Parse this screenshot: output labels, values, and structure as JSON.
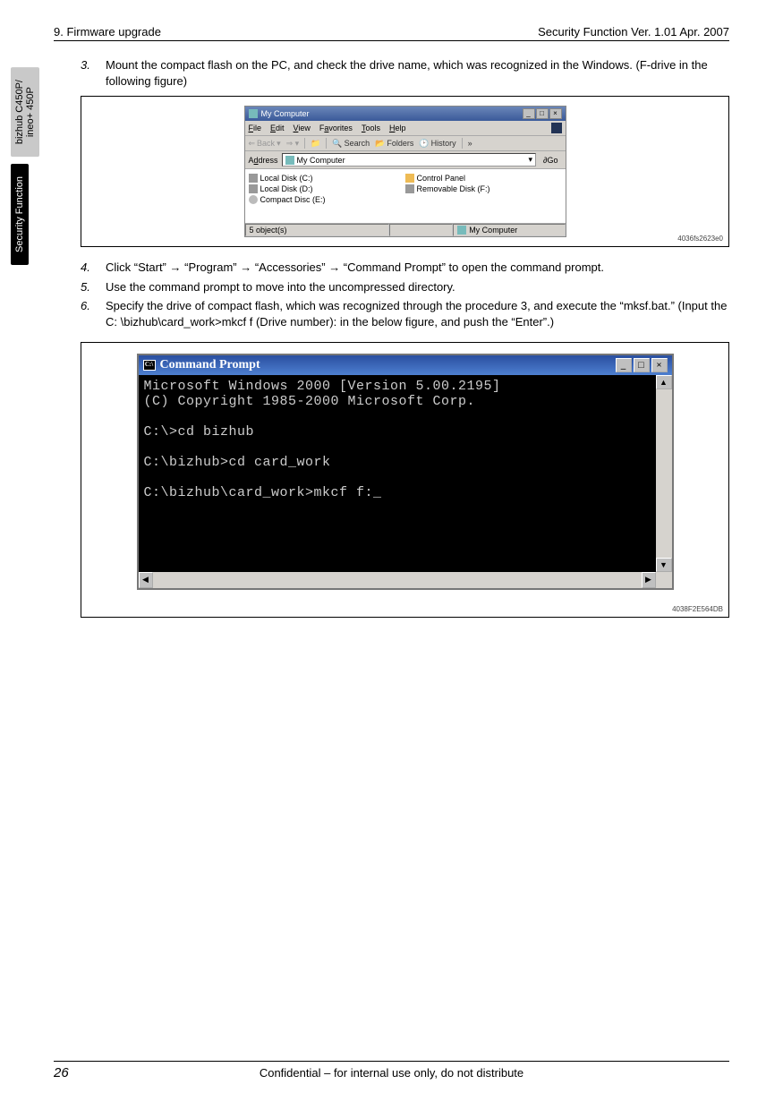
{
  "header": {
    "left": "9. Firmware upgrade",
    "right": "Security Function Ver. 1.01 Apr. 2007"
  },
  "sidetabs": {
    "grey": "bizhub C450P/\nineo+ 450P",
    "black": "Security Function"
  },
  "steps": {
    "s3": {
      "num": "3.",
      "text": "Mount the compact flash on the PC, and check the drive name, which was recognized in the Windows. (F-drive in the following figure)"
    },
    "s4": {
      "num": "4.",
      "text": "Click “Start” → “Program” → “Accessories” → “Command Prompt” to open the command prompt."
    },
    "s5": {
      "num": "5.",
      "text": "Use the command prompt to move into the uncompressed directory."
    },
    "s6": {
      "num": "6.",
      "text": "Specify the drive of compact flash, which was recognized through the procedure 3, and execute the “mksf.bat.” (Input the C: \\bizhub\\card_work>mkcf f (Drive number): in the below figure, and push the “Enter”.)"
    }
  },
  "fig1": {
    "title": "My Computer",
    "menus": {
      "file": "File",
      "edit": "Edit",
      "view": "View",
      "favorites": "Favorites",
      "tools": "Tools",
      "help": "Help"
    },
    "toolbar": {
      "back": "Back",
      "search": "Search",
      "folders": "Folders",
      "history": "History"
    },
    "address_label": "Address",
    "address_value": "My Computer",
    "go": "Go",
    "items": {
      "c": "Local Disk (C:)",
      "d": "Local Disk (D:)",
      "e": "Compact Disc (E:)",
      "cp": "Control Panel",
      "f": "Removable Disk (F:)"
    },
    "status_left": "5 object(s)",
    "status_right": "My Computer",
    "id": "4036fs2623e0"
  },
  "fig2": {
    "title": "Command Prompt",
    "lines": "Microsoft Windows 2000 [Version 5.00.2195]\n(C) Copyright 1985-2000 Microsoft Corp.\n\nC:\\>cd bizhub\n\nC:\\bizhub>cd card_work\n\nC:\\bizhub\\card_work>mkcf f:_",
    "id": "4038F2E564DB"
  },
  "footer": {
    "page": "26",
    "conf": "Confidential – for internal use only, do not distribute"
  }
}
